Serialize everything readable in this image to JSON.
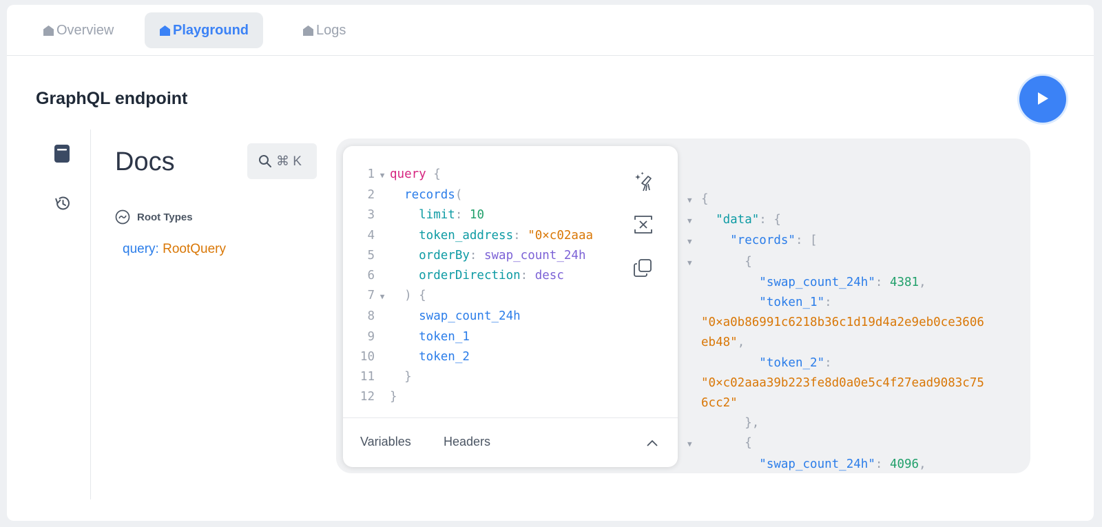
{
  "tabs": [
    {
      "label": "Overview",
      "active": false
    },
    {
      "label": "Playground",
      "active": true
    },
    {
      "label": "Logs",
      "active": false
    }
  ],
  "header": {
    "title": "GraphQL endpoint",
    "run_icon": "play-icon"
  },
  "sidebar": {
    "icons": [
      "book-icon",
      "history-icon"
    ]
  },
  "docs": {
    "title": "Docs",
    "search_hint": "⌘ K",
    "root_types_label": "Root Types",
    "root_field_name": "query",
    "root_field_sep": ": ",
    "root_field_type": "RootQuery"
  },
  "editor": {
    "line_numbers": [
      "1",
      "2",
      "3",
      "4",
      "5",
      "6",
      "7",
      "8",
      "9",
      "10",
      "11",
      "12"
    ],
    "foldable_lines": [
      1,
      7
    ],
    "tools": [
      "prettify-icon",
      "merge-icon",
      "copy-icon"
    ],
    "footer": {
      "variables_tab": "Variables",
      "headers_tab": "Headers"
    }
  },
  "query_tokens": [
    [
      {
        "t": "query",
        "c": "kw"
      },
      {
        "t": " {",
        "c": "pn"
      }
    ],
    [
      {
        "t": "  records",
        "c": "fn"
      },
      {
        "t": "(",
        "c": "pn"
      }
    ],
    [
      {
        "t": "    limit",
        "c": "arg"
      },
      {
        "t": ": ",
        "c": "pn"
      },
      {
        "t": "10",
        "c": "num"
      }
    ],
    [
      {
        "t": "    token_address",
        "c": "arg"
      },
      {
        "t": ": ",
        "c": "pn"
      },
      {
        "t": "\"0×c02aaa",
        "c": "str"
      }
    ],
    [
      {
        "t": "    orderBy",
        "c": "arg"
      },
      {
        "t": ": ",
        "c": "pn"
      },
      {
        "t": "swap_count_24h",
        "c": "en"
      }
    ],
    [
      {
        "t": "    orderDirection",
        "c": "arg"
      },
      {
        "t": ": ",
        "c": "pn"
      },
      {
        "t": "desc",
        "c": "en"
      }
    ],
    [
      {
        "t": "  ) {",
        "c": "pn"
      }
    ],
    [
      {
        "t": "    swap_count_24h",
        "c": "fn"
      }
    ],
    [
      {
        "t": "    token_1",
        "c": "fn"
      }
    ],
    [
      {
        "t": "    token_2",
        "c": "fn"
      }
    ],
    [
      {
        "t": "  }",
        "c": "pn"
      }
    ],
    [
      {
        "t": "}",
        "c": "pn"
      }
    ]
  ],
  "result_lines": [
    {
      "fold": true,
      "tokens": [
        {
          "t": "{",
          "c": "pn"
        }
      ]
    },
    {
      "fold": true,
      "tokens": [
        {
          "t": "  \"data\"",
          "c": "arg"
        },
        {
          "t": ": {",
          "c": "pn"
        }
      ]
    },
    {
      "fold": true,
      "tokens": [
        {
          "t": "    \"records\"",
          "c": "rk"
        },
        {
          "t": ": [",
          "c": "pn"
        }
      ]
    },
    {
      "fold": true,
      "tokens": [
        {
          "t": "      {",
          "c": "pn"
        }
      ]
    },
    {
      "fold": false,
      "tokens": [
        {
          "t": "        \"swap_count_24h\"",
          "c": "rk"
        },
        {
          "t": ": ",
          "c": "pn"
        },
        {
          "t": "4381",
          "c": "rn"
        },
        {
          "t": ",",
          "c": "pn"
        }
      ]
    },
    {
      "fold": false,
      "tokens": [
        {
          "t": "        \"token_1\"",
          "c": "rk"
        },
        {
          "t": ":",
          "c": "pn"
        }
      ]
    },
    {
      "fold": false,
      "tokens": [
        {
          "t": "\"0×a0b86991c6218b36c1d19d4a2e9eb0ce3606",
          "c": "rs"
        }
      ]
    },
    {
      "fold": false,
      "tokens": [
        {
          "t": "eb48\"",
          "c": "rs"
        },
        {
          "t": ",",
          "c": "pn"
        }
      ]
    },
    {
      "fold": false,
      "tokens": [
        {
          "t": "        \"token_2\"",
          "c": "rk"
        },
        {
          "t": ":",
          "c": "pn"
        }
      ]
    },
    {
      "fold": false,
      "tokens": [
        {
          "t": "\"0×c02aaa39b223fe8d0a0e5c4f27ead9083c75",
          "c": "rs"
        }
      ]
    },
    {
      "fold": false,
      "tokens": [
        {
          "t": "6cc2\"",
          "c": "rs"
        }
      ]
    },
    {
      "fold": false,
      "tokens": [
        {
          "t": "      },",
          "c": "pn"
        }
      ]
    },
    {
      "fold": true,
      "tokens": [
        {
          "t": "      {",
          "c": "pn"
        }
      ]
    },
    {
      "fold": false,
      "tokens": [
        {
          "t": "        \"swap_count_24h\"",
          "c": "rk"
        },
        {
          "t": ": ",
          "c": "pn"
        },
        {
          "t": "4096",
          "c": "rn"
        },
        {
          "t": ",",
          "c": "pn"
        }
      ]
    }
  ]
}
